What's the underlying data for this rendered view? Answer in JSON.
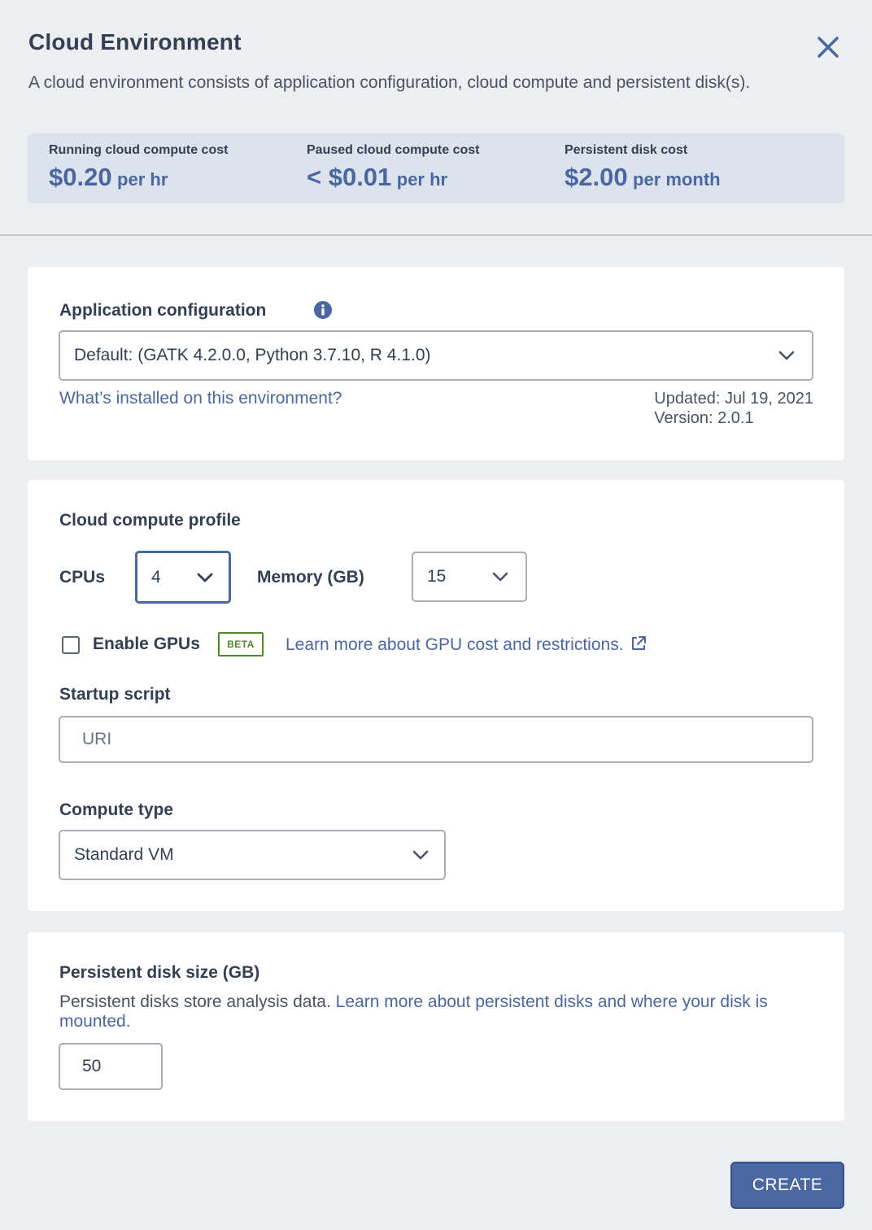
{
  "header": {
    "title": "Cloud Environment",
    "description": "A cloud environment consists of application configuration, cloud compute and persistent disk(s)."
  },
  "costs": [
    {
      "label": "Running cloud compute cost",
      "amount": "$0.20",
      "unit": "per hr"
    },
    {
      "label": "Paused cloud compute cost",
      "amount": "< $0.01",
      "unit": "per hr"
    },
    {
      "label": "Persistent disk cost",
      "amount": "$2.00",
      "unit": "per month"
    }
  ],
  "app_config": {
    "label": "Application configuration",
    "selected": "Default: (GATK 4.2.0.0, Python 3.7.10, R 4.1.0)",
    "installed_link": "What’s installed on this environment?",
    "updated": "Updated: Jul 19, 2021",
    "version": "Version: 2.0.1"
  },
  "compute": {
    "label": "Cloud compute profile",
    "cpus_label": "CPUs",
    "cpus_value": "4",
    "memory_label": "Memory (GB)",
    "memory_value": "15",
    "gpu_label": "Enable GPUs",
    "gpu_enabled": false,
    "beta_badge": "BETA",
    "gpu_link": "Learn more about GPU cost and restrictions.",
    "startup_label": "Startup script",
    "startup_placeholder": "URI",
    "startup_value": "",
    "type_label": "Compute type",
    "type_value": "Standard VM"
  },
  "disk": {
    "label": "Persistent disk size (GB)",
    "desc_text": "Persistent disks store analysis data.",
    "desc_link": "Learn more about persistent disks and where your disk is mounted.",
    "size_value": "50"
  },
  "actions": {
    "create_label": "CREATE"
  },
  "colors": {
    "accent": "#4a67a1",
    "background": "#eceef1",
    "cost_panel": "#dde3ec",
    "beta_green": "#4f8a2c"
  }
}
